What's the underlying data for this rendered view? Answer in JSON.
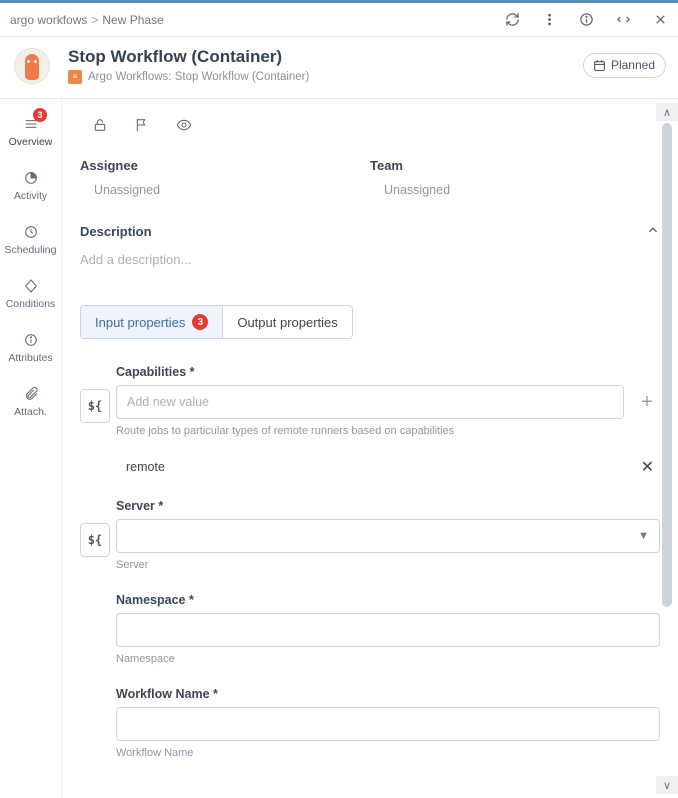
{
  "breadcrumb": {
    "root": "argo workfows",
    "current": "New Phase"
  },
  "header": {
    "title": "Stop Workflow (Container)",
    "subtitle": "Argo Workflows: Stop Workflow (Container)",
    "badge": "Planned"
  },
  "sidenav": {
    "overview_badge": "3",
    "items": [
      "Overview",
      "Activity",
      "Scheduling",
      "Conditions",
      "Attributes",
      "Attach."
    ]
  },
  "meta": {
    "assignee_label": "Assignee",
    "assignee_value": "Unassigned",
    "team_label": "Team",
    "team_value": "Unassigned"
  },
  "description": {
    "label": "Description",
    "placeholder": "Add a description..."
  },
  "tabs": {
    "input_label": "Input properties",
    "input_count": "3",
    "output_label": "Output properties"
  },
  "form": {
    "capabilities": {
      "label": "Capabilities *",
      "placeholder": "Add new value",
      "help": "Route jobs to particular types of remote runners based on capabilities",
      "chip": "remote"
    },
    "server": {
      "label": "Server *",
      "help": "Server"
    },
    "namespace": {
      "label": "Namespace *",
      "help": "Namespace"
    },
    "workflow_name": {
      "label": "Workflow Name *",
      "help": "Workflow Name"
    }
  }
}
